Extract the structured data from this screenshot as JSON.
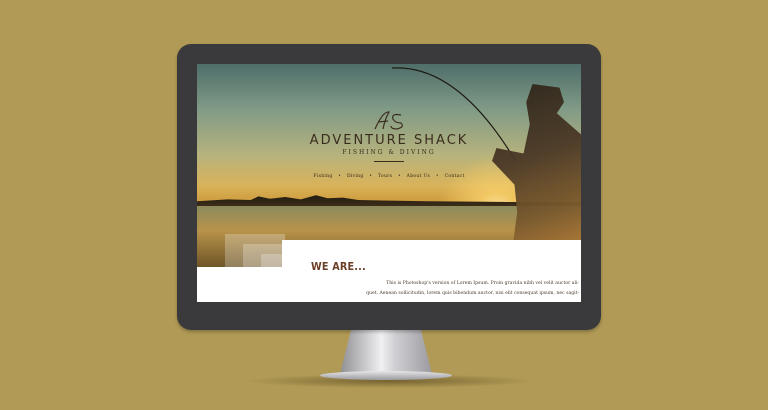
{
  "brand": {
    "title": "ADVENTURE SHACK",
    "subtitle": "FISHING & DIVING"
  },
  "nav": {
    "items": [
      {
        "label": "Fishing"
      },
      {
        "label": "Diving"
      },
      {
        "label": "Tours"
      },
      {
        "label": "About Us"
      },
      {
        "label": "Contact"
      }
    ],
    "separator": "•"
  },
  "about": {
    "heading": "WE ARE...",
    "line1": "This is Photoshop's version  of Lorem Ipsum. Proin gravida nibh vel velit auctor ali-",
    "line2": "quet. Aenean sollicitudin, lorem quis bibendum auctor, nisi elit consequat ipsum, nec sagit-"
  },
  "colors": {
    "background": "#b09a55",
    "monitor_bezel": "#3a3a3c",
    "brand_text": "#3b2d1e",
    "heading": "#6b3f27"
  },
  "icons": {
    "logo": "as-monogram-logo"
  }
}
